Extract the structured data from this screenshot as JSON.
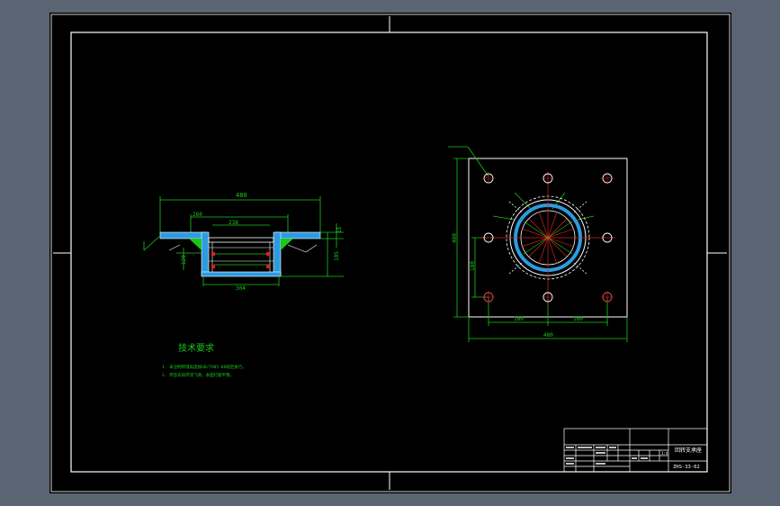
{
  "colors": {
    "background_outer": "#5b6472",
    "sheet": "#000000",
    "frame": "#ffffff",
    "dimension": "#19c819",
    "part_outline": "#ffffff",
    "section_fill": "#2d9be0",
    "centerline": "#e02020",
    "hidden_bolt": "#e05050",
    "title_text": "#ffffff"
  },
  "section_view": {
    "dim_top": "480",
    "dim_flange_right": "15",
    "dim_height_right": "105",
    "dim_bottom": "304",
    "dim_inner": "238",
    "dim_mid": "260",
    "dim_left_vertical": "120"
  },
  "plan_view": {
    "dim_width": "480",
    "dim_height": "480",
    "dim_left_inner": "180",
    "dim_bottom_left": "180",
    "dim_bottom_right": "180"
  },
  "tech_req": {
    "title": "技术要求",
    "line1": "1. 未注明焊缝高度按GB/T985-88规定执行。",
    "line2": "2. 焊后去除焊渣飞溅，表面打磨平整。"
  },
  "title_block": {
    "scale": "1:4",
    "drawing_name": "回转支承座",
    "drawing_number": "ZHS-33-02"
  }
}
